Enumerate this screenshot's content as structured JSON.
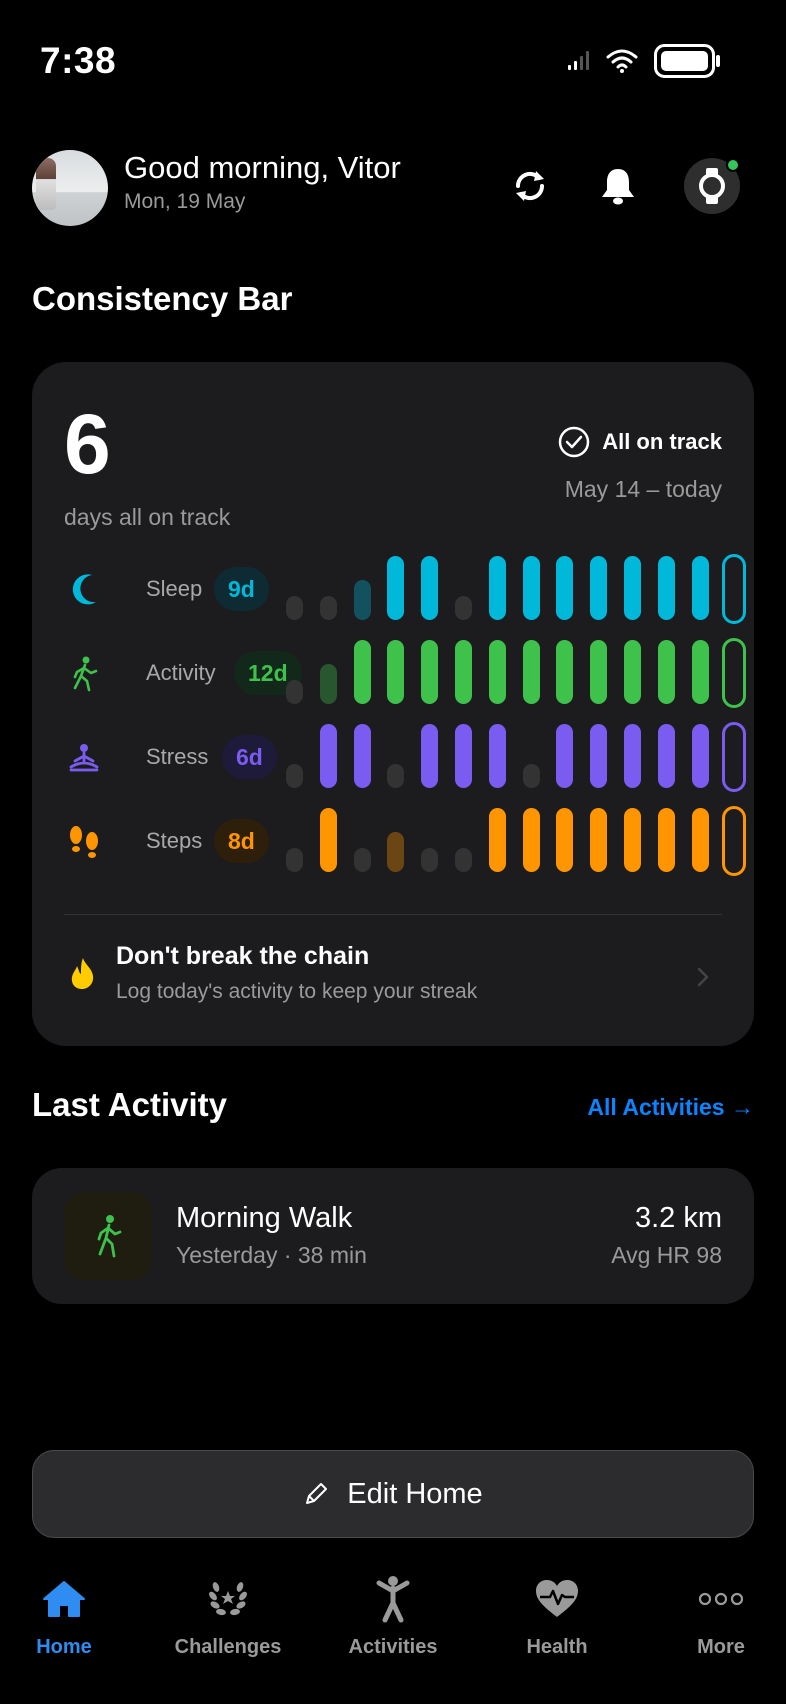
{
  "status_bar": {
    "time": "7:38"
  },
  "header": {
    "greeting": "Good morning, Vitor",
    "date": "Mon, 19 May"
  },
  "consistency": {
    "section_title": "Consistency Bar",
    "days_count": "6",
    "days_label": "days all on track",
    "status_label": "All on track",
    "range_label": "May 14 – today",
    "metrics": [
      {
        "label": "Sleep",
        "badge": "9d",
        "color": "#00b8d9",
        "badge_bg": "#0e2a33",
        "icon": "moon-icon",
        "levels": [
          "off",
          "off",
          "dim",
          "on",
          "on",
          "off",
          "on",
          "on",
          "on",
          "on",
          "on",
          "on",
          "on",
          "today"
        ]
      },
      {
        "label": "Activity",
        "badge": "12d",
        "color": "#3ec24c",
        "badge_bg": "#11281a",
        "icon": "walking-person-icon",
        "levels": [
          "off",
          "dim",
          "on",
          "on",
          "on",
          "on",
          "on",
          "on",
          "on",
          "on",
          "on",
          "on",
          "on",
          "today"
        ]
      },
      {
        "label": "Stress",
        "badge": "6d",
        "color": "#7b5cf0",
        "badge_bg": "#1d1a3a",
        "icon": "meditation-icon",
        "levels": [
          "off",
          "on",
          "on",
          "off",
          "on",
          "on",
          "on",
          "off",
          "on",
          "on",
          "on",
          "on",
          "on",
          "today"
        ]
      },
      {
        "label": "Steps",
        "badge": "8d",
        "color": "#ff9500",
        "badge_bg": "#2e1f0a",
        "icon": "footprints-icon",
        "levels": [
          "off",
          "on",
          "off",
          "dim",
          "off",
          "off",
          "on",
          "on",
          "on",
          "on",
          "on",
          "on",
          "on",
          "today"
        ]
      }
    ],
    "chain": {
      "title": "Don't break the chain",
      "subtitle": "Log today's activity to keep your streak"
    }
  },
  "last_activity": {
    "section_title": "Last Activity",
    "link_label": "All Activities →",
    "item": {
      "name": "Morning Walk",
      "meta": "Yesterday · 38 min",
      "distance": "3.2 km",
      "heart_rate": "Avg HR 98"
    }
  },
  "edit_home": {
    "label": "Edit Home"
  },
  "tabbar": {
    "tabs": [
      {
        "label": "Home",
        "icon": "home-icon",
        "active": true
      },
      {
        "label": "Challenges",
        "icon": "laurel-icon",
        "active": false
      },
      {
        "label": "Activities",
        "icon": "person-icon",
        "active": false
      },
      {
        "label": "Health",
        "icon": "heart-pulse-icon",
        "active": false
      },
      {
        "label": "More",
        "icon": "more-dots-icon",
        "active": false
      }
    ]
  }
}
